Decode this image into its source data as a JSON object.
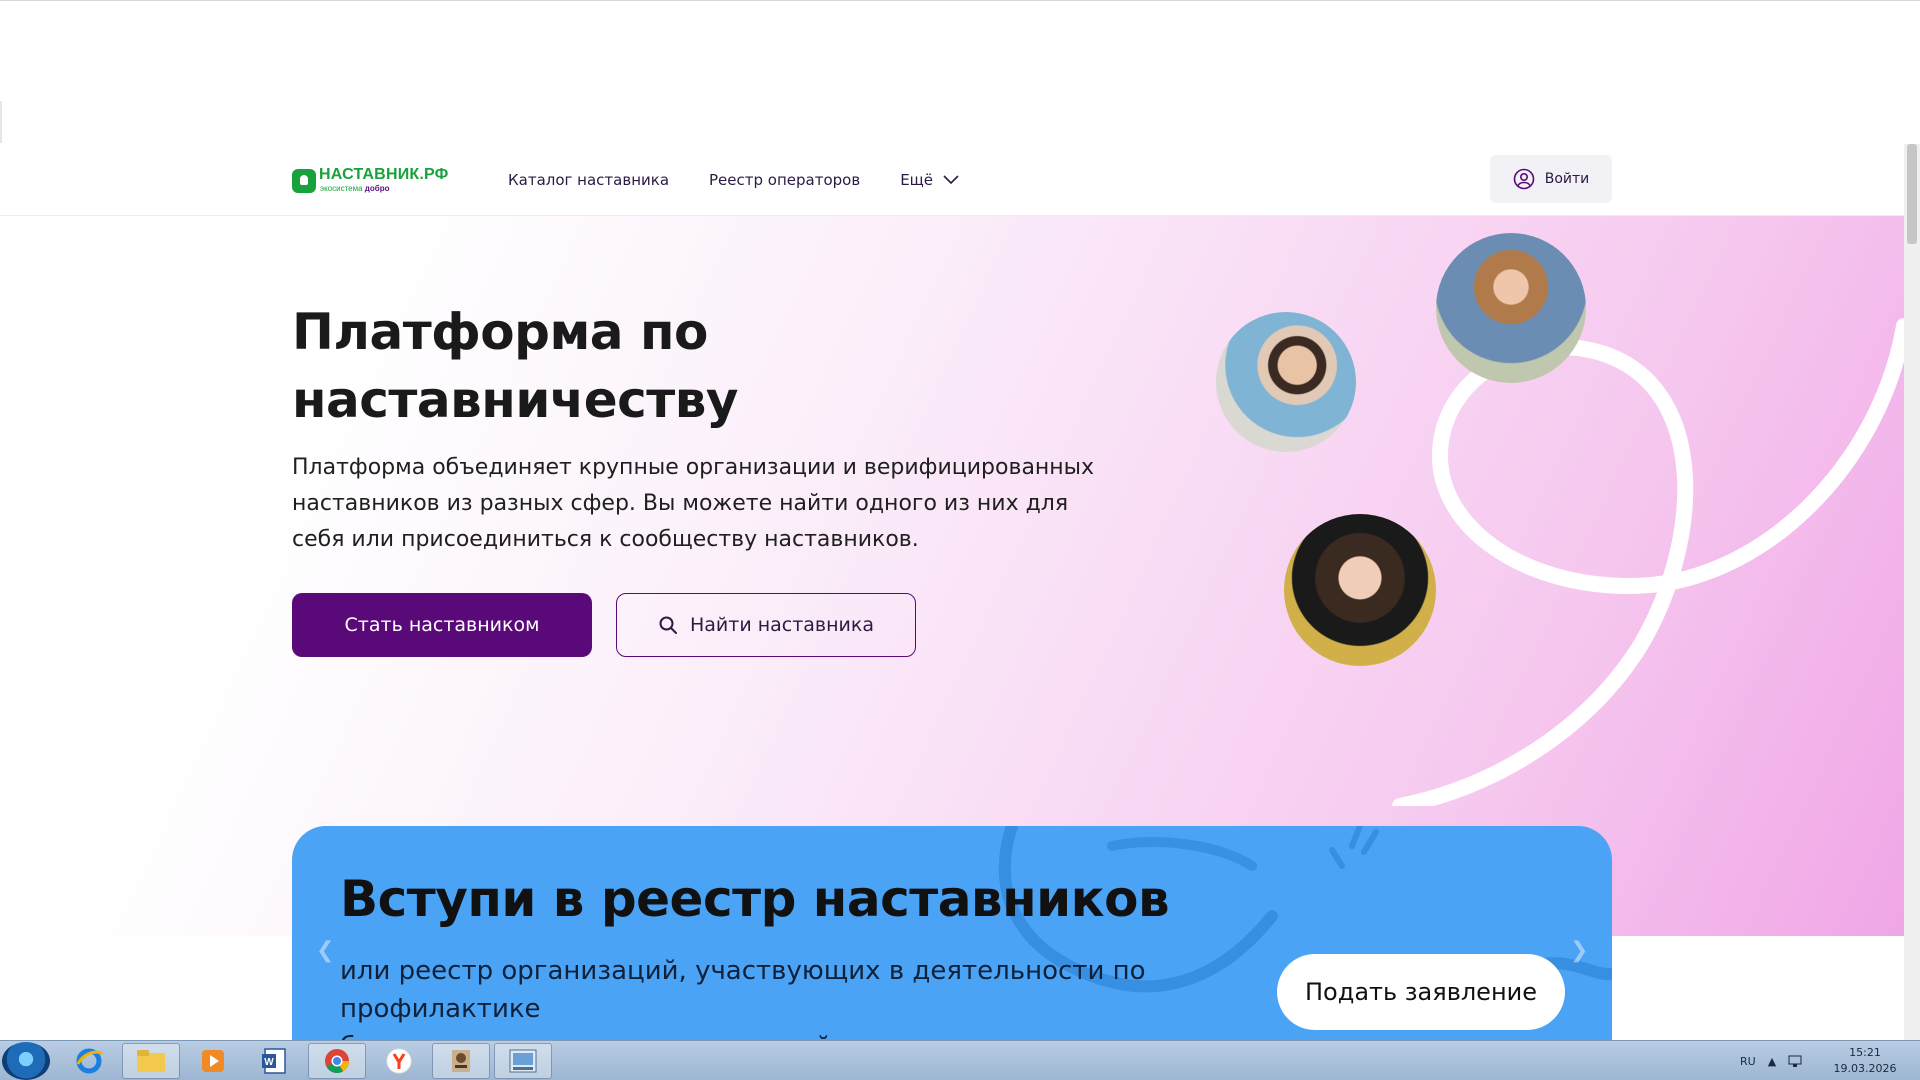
{
  "header": {
    "logo_title": "НАСТАВНИК.РФ",
    "logo_sub_prefix": "экосистема",
    "logo_sub_brand": "добро",
    "nav": [
      {
        "label": "Каталог наставника"
      },
      {
        "label": "Реестр операторов"
      },
      {
        "label": "Ещё"
      }
    ],
    "login_label": "Войти"
  },
  "hero": {
    "title_line1": "Платформа по",
    "title_line2": "наставничеству",
    "desc_line1": "Платформа объединяет крупные организации и верифицированных",
    "desc_line2": "наставников из разных сфер. Вы можете найти одного из них для",
    "desc_line3": "себя или присоединиться к сообществу наставников.",
    "primary_button": "Стать наставником",
    "secondary_button": "Найти наставника"
  },
  "banner": {
    "title": "Вступи в реестр наставников",
    "sub_line1": "или реестр организаций, участвующих в деятельности по профилактике",
    "sub_line2": "безнадзорности и правонарушений несовершеннолетних",
    "button": "Подать заявление"
  },
  "taskbar": {
    "language": "RU",
    "time": "15:21",
    "date": "19.03.2026"
  },
  "colors": {
    "brand_green": "#19a23c",
    "brand_purple": "#5a0a78",
    "banner_blue": "#4aa3f5"
  }
}
